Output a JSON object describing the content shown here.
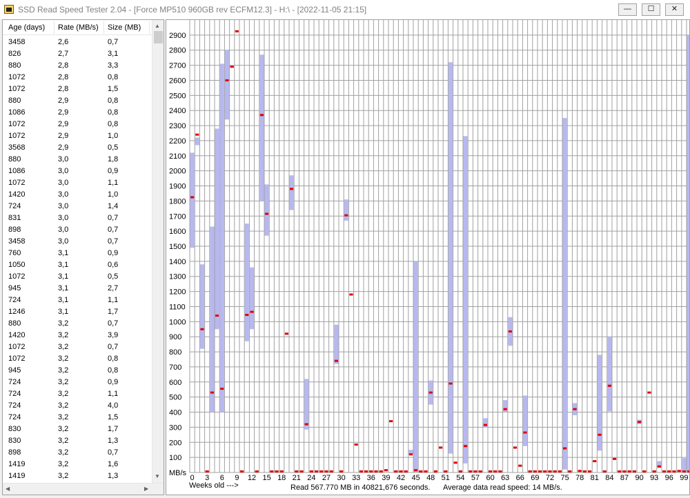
{
  "window": {
    "title": "SSD Read Speed Tester 2.04 - [Force MP510 960GB rev ECFM12.3] - H:\\ - [2022-11-05 21:15]",
    "minimize_glyph": "—",
    "maximize_glyph": "☐",
    "close_glyph": "✕"
  },
  "list": {
    "columns": [
      "Age (days)",
      "Rate (MB/s)",
      "Size (MB)"
    ],
    "rows": [
      [
        "3458",
        "2,6",
        "0,7"
      ],
      [
        "826",
        "2,7",
        "3,1"
      ],
      [
        "880",
        "2,8",
        "3,3"
      ],
      [
        "1072",
        "2,8",
        "0,8"
      ],
      [
        "1072",
        "2,8",
        "1,5"
      ],
      [
        "880",
        "2,9",
        "0,8"
      ],
      [
        "1086",
        "2,9",
        "0,8"
      ],
      [
        "1072",
        "2,9",
        "0,8"
      ],
      [
        "1072",
        "2,9",
        "1,0"
      ],
      [
        "3568",
        "2,9",
        "0,5"
      ],
      [
        "880",
        "3,0",
        "1,8"
      ],
      [
        "1086",
        "3,0",
        "0,9"
      ],
      [
        "1072",
        "3,0",
        "1,1"
      ],
      [
        "1420",
        "3,0",
        "1,0"
      ],
      [
        "724",
        "3,0",
        "1,4"
      ],
      [
        "831",
        "3,0",
        "0,7"
      ],
      [
        "898",
        "3,0",
        "0,7"
      ],
      [
        "3458",
        "3,0",
        "0,7"
      ],
      [
        "760",
        "3,1",
        "0,9"
      ],
      [
        "1050",
        "3,1",
        "0,6"
      ],
      [
        "1072",
        "3,1",
        "0,5"
      ],
      [
        "945",
        "3,1",
        "2,7"
      ],
      [
        "724",
        "3,1",
        "1,1"
      ],
      [
        "1246",
        "3,1",
        "1,7"
      ],
      [
        "880",
        "3,2",
        "0,7"
      ],
      [
        "1420",
        "3,2",
        "3,9"
      ],
      [
        "1072",
        "3,2",
        "0,7"
      ],
      [
        "1072",
        "3,2",
        "0,8"
      ],
      [
        "945",
        "3,2",
        "0,8"
      ],
      [
        "724",
        "3,2",
        "0,9"
      ],
      [
        "724",
        "3,2",
        "1,1"
      ],
      [
        "724",
        "3,2",
        "4,0"
      ],
      [
        "724",
        "3,2",
        "1,5"
      ],
      [
        "830",
        "3,2",
        "1,7"
      ],
      [
        "830",
        "3,2",
        "1,3"
      ],
      [
        "898",
        "3,2",
        "0,7"
      ],
      [
        "1419",
        "3,2",
        "1,6"
      ],
      [
        "1419",
        "3,2",
        "1,3"
      ]
    ],
    "scroll_up": "▲",
    "scroll_down": "▼",
    "scroll_left": "◀",
    "scroll_right": "▶"
  },
  "chart_data": {
    "type": "bar",
    "ylabel": "MB/s",
    "xlabel": "Weeks old --->",
    "ylim": [
      0,
      3000
    ],
    "y_ticks": [
      100,
      200,
      300,
      400,
      500,
      600,
      700,
      800,
      900,
      1000,
      1100,
      1200,
      1300,
      1400,
      1500,
      1600,
      1700,
      1800,
      1900,
      2000,
      2100,
      2200,
      2300,
      2400,
      2500,
      2600,
      2700,
      2800,
      2900
    ],
    "x_tick_labels": [
      0,
      3,
      6,
      9,
      12,
      15,
      18,
      21,
      24,
      27,
      30,
      33,
      36,
      39,
      42,
      45,
      48,
      51,
      54,
      57,
      60,
      63,
      66,
      69,
      72,
      75,
      78,
      81,
      84,
      87,
      90,
      93,
      96,
      99
    ],
    "grid": true,
    "colors": {
      "range": "#b8b8f0",
      "average": "#e00000",
      "grid": "#a0a0a0"
    },
    "weeks": [
      {
        "week": 0,
        "min": 1490,
        "max": 2120,
        "avg": 1825
      },
      {
        "week": 1,
        "min": 2170,
        "max": 2220,
        "avg": 2240
      },
      {
        "week": 2,
        "min": 820,
        "max": 1380,
        "avg": 950
      },
      {
        "week": 3,
        "min": 0,
        "max": 0,
        "avg": 0
      },
      {
        "week": 4,
        "min": 400,
        "max": 1630,
        "avg": 530
      },
      {
        "week": 5,
        "min": 950,
        "max": 2280,
        "avg": 1040
      },
      {
        "week": 6,
        "min": 400,
        "max": 2710,
        "avg": 555
      },
      {
        "week": 7,
        "min": 2340,
        "max": 2800,
        "avg": 2600
      },
      {
        "week": 8,
        "min": 2690,
        "max": 2700,
        "avg": 2690
      },
      {
        "week": 9,
        "min": 2930,
        "max": 2930,
        "avg": 2925
      },
      {
        "week": 10,
        "min": 0,
        "max": 0,
        "avg": 0
      },
      {
        "week": 11,
        "min": 870,
        "max": 1650,
        "avg": 1045
      },
      {
        "week": 12,
        "min": 950,
        "max": 1360,
        "avg": 1065
      },
      {
        "week": 13,
        "min": 0,
        "max": 0,
        "avg": 0
      },
      {
        "week": 14,
        "min": 1800,
        "max": 2770,
        "avg": 2370
      },
      {
        "week": 15,
        "min": 1570,
        "max": 1910,
        "avg": 1715
      },
      {
        "week": 16,
        "min": 0,
        "max": 0,
        "avg": 0
      },
      {
        "week": 17,
        "min": 0,
        "max": 0,
        "avg": 0
      },
      {
        "week": 18,
        "min": 0,
        "max": 0,
        "avg": 0
      },
      {
        "week": 19,
        "min": 920,
        "max": 920,
        "avg": 920
      },
      {
        "week": 20,
        "min": 1740,
        "max": 1970,
        "avg": 1880
      },
      {
        "week": 21,
        "min": 0,
        "max": 0,
        "avg": 0
      },
      {
        "week": 22,
        "min": 0,
        "max": 0,
        "avg": 0
      },
      {
        "week": 23,
        "min": 285,
        "max": 620,
        "avg": 320
      },
      {
        "week": 24,
        "min": 0,
        "max": 0,
        "avg": 0
      },
      {
        "week": 25,
        "min": 0,
        "max": 0,
        "avg": 0
      },
      {
        "week": 26,
        "min": 0,
        "max": 0,
        "avg": 0
      },
      {
        "week": 27,
        "min": 0,
        "max": 0,
        "avg": 0
      },
      {
        "week": 28,
        "min": 0,
        "max": 0,
        "avg": 0
      },
      {
        "week": 29,
        "min": 720,
        "max": 980,
        "avg": 740
      },
      {
        "week": 30,
        "min": 0,
        "max": 0,
        "avg": 0
      },
      {
        "week": 31,
        "min": 1670,
        "max": 1810,
        "avg": 1705
      },
      {
        "week": 32,
        "min": 1180,
        "max": 1180,
        "avg": 1180
      },
      {
        "week": 33,
        "min": 185,
        "max": 185,
        "avg": 185
      },
      {
        "week": 34,
        "min": 0,
        "max": 0,
        "avg": 0
      },
      {
        "week": 35,
        "min": 0,
        "max": 0,
        "avg": 0
      },
      {
        "week": 36,
        "min": 0,
        "max": 0,
        "avg": 0
      },
      {
        "week": 37,
        "min": 0,
        "max": 0,
        "avg": 0
      },
      {
        "week": 38,
        "min": 0,
        "max": 0,
        "avg": 0
      },
      {
        "week": 39,
        "min": 15,
        "max": 15,
        "avg": 15
      },
      {
        "week": 40,
        "min": 340,
        "max": 340,
        "avg": 340
      },
      {
        "week": 41,
        "min": 0,
        "max": 0,
        "avg": 0
      },
      {
        "week": 42,
        "min": 0,
        "max": 0,
        "avg": 0
      },
      {
        "week": 43,
        "min": 0,
        "max": 0,
        "avg": 0
      },
      {
        "week": 44,
        "min": 120,
        "max": 150,
        "avg": 120
      },
      {
        "week": 45,
        "min": 0,
        "max": 1400,
        "avg": 15
      },
      {
        "week": 46,
        "min": 0,
        "max": 0,
        "avg": 5
      },
      {
        "week": 47,
        "min": 0,
        "max": 0,
        "avg": 0
      },
      {
        "week": 48,
        "min": 450,
        "max": 610,
        "avg": 530
      },
      {
        "week": 49,
        "min": 0,
        "max": 0,
        "avg": 0
      },
      {
        "week": 50,
        "min": 165,
        "max": 165,
        "avg": 165
      },
      {
        "week": 51,
        "min": 0,
        "max": 0,
        "avg": 0
      },
      {
        "week": 52,
        "min": 125,
        "max": 2720,
        "avg": 590
      },
      {
        "week": 53,
        "min": 65,
        "max": 65,
        "avg": 65
      },
      {
        "week": 54,
        "min": 0,
        "max": 0,
        "avg": 0
      },
      {
        "week": 55,
        "min": 60,
        "max": 2230,
        "avg": 175
      },
      {
        "week": 56,
        "min": 0,
        "max": 0,
        "avg": 0
      },
      {
        "week": 57,
        "min": 0,
        "max": 0,
        "avg": 0
      },
      {
        "week": 58,
        "min": 0,
        "max": 0,
        "avg": 0
      },
      {
        "week": 59,
        "min": 300,
        "max": 360,
        "avg": 315
      },
      {
        "week": 60,
        "min": 0,
        "max": 0,
        "avg": 0
      },
      {
        "week": 61,
        "min": 0,
        "max": 0,
        "avg": 0
      },
      {
        "week": 62,
        "min": 0,
        "max": 0,
        "avg": 0
      },
      {
        "week": 63,
        "min": 400,
        "max": 480,
        "avg": 420
      },
      {
        "week": 64,
        "min": 840,
        "max": 1030,
        "avg": 935
      },
      {
        "week": 65,
        "min": 165,
        "max": 165,
        "avg": 165
      },
      {
        "week": 66,
        "min": 45,
        "max": 45,
        "avg": 45
      },
      {
        "week": 67,
        "min": 175,
        "max": 510,
        "avg": 265
      },
      {
        "week": 68,
        "min": 0,
        "max": 0,
        "avg": 0
      },
      {
        "week": 69,
        "min": 0,
        "max": 0,
        "avg": 0
      },
      {
        "week": 70,
        "min": 0,
        "max": 0,
        "avg": 0
      },
      {
        "week": 71,
        "min": 0,
        "max": 0,
        "avg": 0
      },
      {
        "week": 72,
        "min": 0,
        "max": 0,
        "avg": 0
      },
      {
        "week": 73,
        "min": 0,
        "max": 0,
        "avg": 0
      },
      {
        "week": 74,
        "min": 0,
        "max": 0,
        "avg": 0
      },
      {
        "week": 75,
        "min": 20,
        "max": 2350,
        "avg": 160
      },
      {
        "week": 76,
        "min": 0,
        "max": 0,
        "avg": 0
      },
      {
        "week": 77,
        "min": 380,
        "max": 460,
        "avg": 420
      },
      {
        "week": 78,
        "min": 10,
        "max": 10,
        "avg": 10
      },
      {
        "week": 79,
        "min": 0,
        "max": 0,
        "avg": 0
      },
      {
        "week": 80,
        "min": 0,
        "max": 0,
        "avg": 0
      },
      {
        "week": 81,
        "min": 75,
        "max": 75,
        "avg": 75
      },
      {
        "week": 82,
        "min": 145,
        "max": 780,
        "avg": 250
      },
      {
        "week": 83,
        "min": 0,
        "max": 0,
        "avg": 0
      },
      {
        "week": 84,
        "min": 405,
        "max": 900,
        "avg": 575
      },
      {
        "week": 85,
        "min": 90,
        "max": 90,
        "avg": 90
      },
      {
        "week": 86,
        "min": 0,
        "max": 0,
        "avg": 0
      },
      {
        "week": 87,
        "min": 0,
        "max": 0,
        "avg": 0
      },
      {
        "week": 88,
        "min": 0,
        "max": 0,
        "avg": 0
      },
      {
        "week": 89,
        "min": 0,
        "max": 0,
        "avg": 0
      },
      {
        "week": 90,
        "min": 320,
        "max": 350,
        "avg": 335
      },
      {
        "week": 91,
        "min": 0,
        "max": 0,
        "avg": 0
      },
      {
        "week": 92,
        "min": 530,
        "max": 530,
        "avg": 530
      },
      {
        "week": 93,
        "min": 0,
        "max": 0,
        "avg": 0
      },
      {
        "week": 94,
        "min": 30,
        "max": 75,
        "avg": 40
      },
      {
        "week": 95,
        "min": 0,
        "max": 0,
        "avg": 0
      },
      {
        "week": 96,
        "min": 0,
        "max": 0,
        "avg": 0
      },
      {
        "week": 97,
        "min": 0,
        "max": 0,
        "avg": 0
      },
      {
        "week": 98,
        "min": 10,
        "max": 10,
        "avg": 10
      },
      {
        "week": 99,
        "min": 0,
        "max": 95,
        "avg": 5
      },
      {
        "week": 100,
        "min": 0,
        "max": 2900,
        "avg": 0
      }
    ]
  },
  "footer": {
    "weeks_label": "Weeks old --->",
    "read_summary": "Read 567.770 MB in 40821,676 seconds.",
    "avg_speed": "Average data read speed: 14 MB/s."
  }
}
